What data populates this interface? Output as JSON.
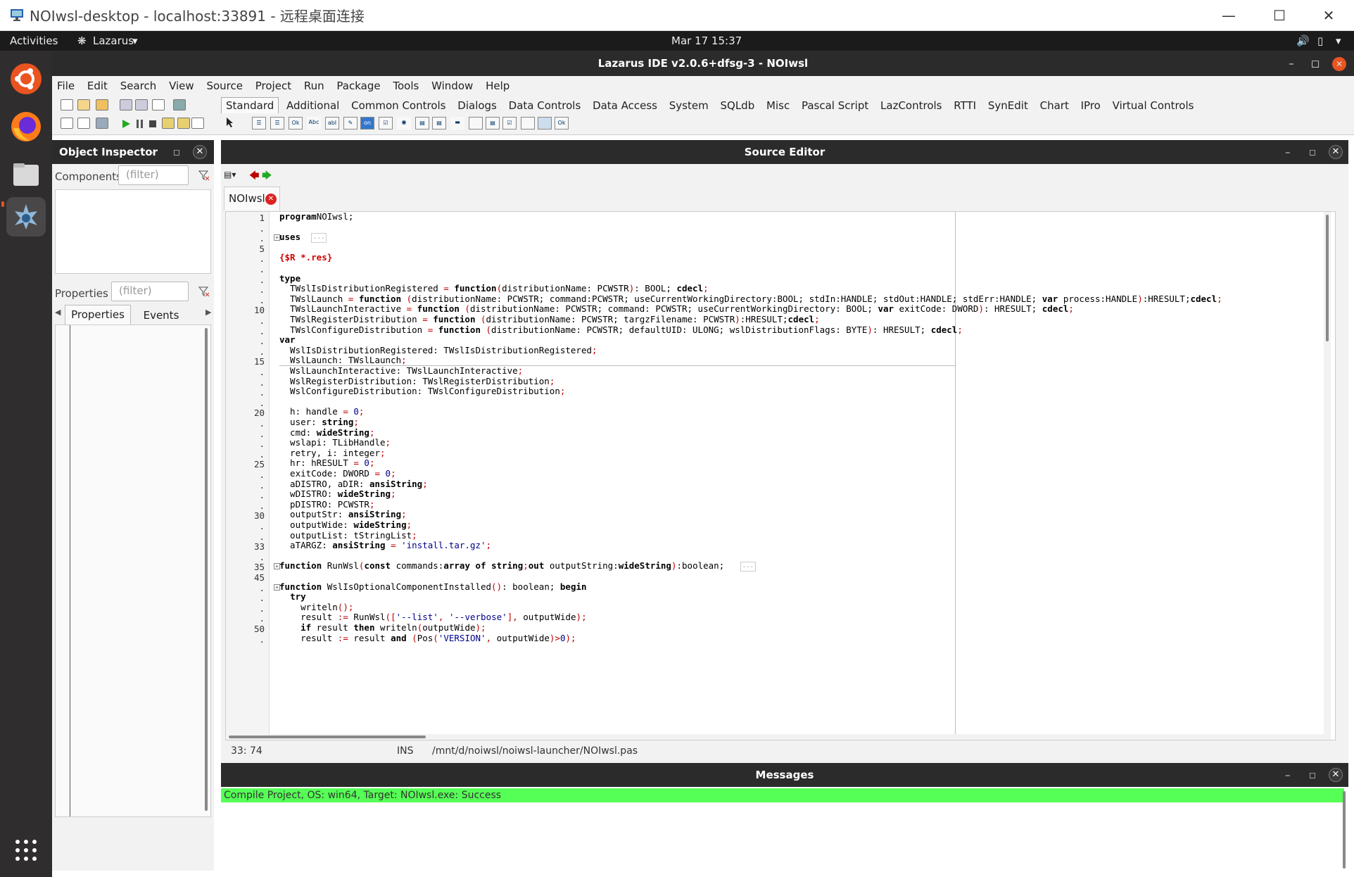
{
  "window": {
    "title": "NOIwsl-desktop - localhost:33891 - 远程桌面连接"
  },
  "gnome": {
    "activities": "Activities",
    "app": "Lazarus",
    "clock": "Mar 17  15:37"
  },
  "ide": {
    "title": "Lazarus IDE v2.0.6+dfsg-3 - NOIwsl"
  },
  "menu": [
    "File",
    "Edit",
    "Search",
    "View",
    "Source",
    "Project",
    "Run",
    "Package",
    "Tools",
    "Window",
    "Help"
  ],
  "component_tabs": [
    "Standard",
    "Additional",
    "Common Controls",
    "Dialogs",
    "Data Controls",
    "Data Access",
    "System",
    "SQLdb",
    "Misc",
    "Pascal Script",
    "LazControls",
    "RTTI",
    "SynEdit",
    "Chart",
    "IPro",
    "Virtual Controls"
  ],
  "palette_icons": [
    "Ok",
    "Abc",
    "abI",
    "on"
  ],
  "object_inspector": {
    "title": "Object Inspector",
    "components_label": "Components",
    "components_filter": "(filter)",
    "properties_label": "Properties",
    "properties_filter": "(filter)",
    "tabs": [
      "Properties",
      "Events"
    ]
  },
  "source_editor": {
    "title": "Source Editor",
    "file_tab": "NOIwsl",
    "gutter": [
      "1",
      ".",
      ".",
      "5",
      ".",
      ".",
      ".",
      ".",
      ".",
      "10",
      ".",
      ".",
      ".",
      ".",
      "15",
      ".",
      ".",
      ".",
      ".",
      "20",
      ".",
      ".",
      ".",
      ".",
      "25",
      ".",
      ".",
      ".",
      ".",
      "30",
      ".",
      ".",
      "33",
      ".",
      "35",
      "45",
      ".",
      ".",
      ".",
      ".",
      "50",
      "."
    ],
    "code": [
      [
        [
          "kw",
          "program"
        ],
        [
          "",
          "NOIwsl;"
        ]
      ],
      [],
      [
        [
          "kw",
          "uses"
        ],
        [
          "",
          "  "
        ],
        [
          "ellip",
          "..."
        ]
      ],
      [],
      [
        [
          "dir",
          "{$R *.res}"
        ]
      ],
      [],
      [
        [
          "kw",
          "type"
        ]
      ],
      [
        [
          "",
          "  TWslIsDistributionRegistered "
        ],
        [
          "sym",
          "="
        ],
        [
          "",
          ""
        ],
        [
          "kw",
          " function"
        ],
        [
          "sym",
          "("
        ],
        [
          "",
          "distributionName: PCWSTR"
        ],
        [
          "sym",
          ")"
        ],
        [
          "",
          ": BOOL; "
        ],
        [
          "kw",
          "cdecl"
        ],
        [
          "sym",
          ";"
        ]
      ],
      [
        [
          "",
          "  TWslLaunch "
        ],
        [
          "sym",
          "="
        ],
        [
          "kw",
          " function "
        ],
        [
          "sym",
          "("
        ],
        [
          "",
          "distributionName: PCWSTR; command:PCWSTR; useCurrentWorkingDirectory:BOOL; stdIn:HANDLE; stdOut:HANDLE; stdErr:HANDLE; "
        ],
        [
          "kw",
          "var"
        ],
        [
          "",
          " process:HANDLE"
        ],
        [
          "sym",
          ")"
        ],
        [
          "",
          ":HRESULT;"
        ],
        [
          "kw",
          "cdecl"
        ],
        [
          "sym",
          ";"
        ]
      ],
      [
        [
          "",
          "  TWslLaunchInteractive "
        ],
        [
          "sym",
          "="
        ],
        [
          "kw",
          " function "
        ],
        [
          "sym",
          "("
        ],
        [
          "",
          "distributionName: PCWSTR; command: PCWSTR; useCurrentWorkingDirectory: BOOL; "
        ],
        [
          "kw",
          "var"
        ],
        [
          "",
          " exitCode: DWORD"
        ],
        [
          "sym",
          ")"
        ],
        [
          "",
          ": HRESULT; "
        ],
        [
          "kw",
          "cdecl"
        ],
        [
          "sym",
          ";"
        ]
      ],
      [
        [
          "",
          "  TWslRegisterDistribution "
        ],
        [
          "sym",
          "="
        ],
        [
          "kw",
          " function "
        ],
        [
          "sym",
          "("
        ],
        [
          "",
          "distributionName: PCWSTR; targzFilename: PCWSTR"
        ],
        [
          "sym",
          ")"
        ],
        [
          "",
          ":HRESULT;"
        ],
        [
          "kw",
          "cdecl"
        ],
        [
          "sym",
          ";"
        ]
      ],
      [
        [
          "",
          "  TWslConfigureDistribution "
        ],
        [
          "sym",
          "="
        ],
        [
          "kw",
          " function "
        ],
        [
          "sym",
          "("
        ],
        [
          "",
          "distributionName: PCWSTR; defaultUID: ULONG; wslDistributionFlags: BYTE"
        ],
        [
          "sym",
          ")"
        ],
        [
          "",
          ": HRESULT; "
        ],
        [
          "kw",
          "cdecl"
        ],
        [
          "sym",
          ";"
        ]
      ],
      [
        [
          "kw",
          "var"
        ]
      ],
      [
        [
          "",
          "  WslIsDistributionRegistered: TWslIsDistributionRegistered"
        ],
        [
          "sym",
          ";"
        ]
      ],
      [
        [
          "",
          "  WslLaunch: TWslLaunch"
        ],
        [
          "sym",
          ";"
        ]
      ],
      [
        [
          "",
          "  WslLaunchInteractive: TWslLaunchInteractive"
        ],
        [
          "sym",
          ";"
        ]
      ],
      [
        [
          "",
          "  WslRegisterDistribution: TWslRegisterDistribution"
        ],
        [
          "sym",
          ";"
        ]
      ],
      [
        [
          "",
          "  WslConfigureDistribution: TWslConfigureDistribution"
        ],
        [
          "sym",
          ";"
        ]
      ],
      [],
      [
        [
          "",
          "  h: handle "
        ],
        [
          "sym",
          "="
        ],
        [
          "",
          " "
        ],
        [
          "str",
          "0"
        ],
        [
          "sym",
          ";"
        ]
      ],
      [
        [
          "",
          "  user: "
        ],
        [
          "kw",
          "string"
        ],
        [
          "sym",
          ";"
        ]
      ],
      [
        [
          "",
          "  cmd: "
        ],
        [
          "kw",
          "wideString"
        ],
        [
          "sym",
          ";"
        ]
      ],
      [
        [
          "",
          "  wslapi: TLibHandle"
        ],
        [
          "sym",
          ";"
        ]
      ],
      [
        [
          "",
          "  retry, i: integer"
        ],
        [
          "sym",
          ";"
        ]
      ],
      [
        [
          "",
          "  hr: hRESULT "
        ],
        [
          "sym",
          "="
        ],
        [
          "",
          " "
        ],
        [
          "str",
          "0"
        ],
        [
          "sym",
          ";"
        ]
      ],
      [
        [
          "",
          "  exitCode: DWORD "
        ],
        [
          "sym",
          "="
        ],
        [
          "",
          " "
        ],
        [
          "str",
          "0"
        ],
        [
          "sym",
          ";"
        ]
      ],
      [
        [
          "",
          "  aDISTRO, aDIR: "
        ],
        [
          "kw",
          "ansiString"
        ],
        [
          "sym",
          ";"
        ]
      ],
      [
        [
          "",
          "  wDISTRO: "
        ],
        [
          "kw",
          "wideString"
        ],
        [
          "sym",
          ";"
        ]
      ],
      [
        [
          "",
          "  pDISTRO: PCWSTR"
        ],
        [
          "sym",
          ";"
        ]
      ],
      [
        [
          "",
          "  outputStr: "
        ],
        [
          "kw",
          "ansiString"
        ],
        [
          "sym",
          ";"
        ]
      ],
      [
        [
          "",
          "  outputWide: "
        ],
        [
          "kw",
          "wideString"
        ],
        [
          "sym",
          ";"
        ]
      ],
      [
        [
          "",
          "  outputList: tStringList"
        ],
        [
          "sym",
          ";"
        ]
      ],
      [
        [
          "",
          "  aTARGZ: "
        ],
        [
          "kw",
          "ansiString"
        ],
        [
          "",
          " "
        ],
        [
          "sym",
          "="
        ],
        [
          "",
          " "
        ],
        [
          "str",
          "'install.tar.gz'"
        ],
        [
          "sym",
          ";"
        ]
      ],
      [],
      [
        [
          "kw",
          "function"
        ],
        [
          "",
          " RunWsl"
        ],
        [
          "sym",
          "("
        ],
        [
          "kw",
          "const"
        ],
        [
          "",
          " commands:"
        ],
        [
          "kw",
          "array of string"
        ],
        [
          "sym",
          ";"
        ],
        [
          "kw",
          "out"
        ],
        [
          "",
          " outputString:"
        ],
        [
          "kw",
          "wideString"
        ],
        [
          "sym",
          ")"
        ],
        [
          "",
          ":boolean;   "
        ],
        [
          "ellip",
          "..."
        ]
      ],
      [],
      [
        [
          "kw",
          "function"
        ],
        [
          "",
          " WslIsOptionalComponentInstalled"
        ],
        [
          "sym",
          "()"
        ],
        [
          "",
          ": boolean; "
        ],
        [
          "kw",
          "begin"
        ]
      ],
      [
        [
          "",
          "  "
        ],
        [
          "kw",
          "try"
        ]
      ],
      [
        [
          "",
          "    writeln"
        ],
        [
          "sym",
          "();"
        ]
      ],
      [
        [
          "",
          "    result "
        ],
        [
          "sym",
          ":="
        ],
        [
          "",
          " RunWsl"
        ],
        [
          "sym",
          "(["
        ],
        [
          "str",
          "'--list'"
        ],
        [
          "sym",
          ","
        ],
        [
          "",
          " "
        ],
        [
          "str",
          "'--verbose'"
        ],
        [
          "sym",
          "],"
        ],
        [
          "",
          " outputWide"
        ],
        [
          "sym",
          ");"
        ]
      ],
      [
        [
          "kw",
          "    if"
        ],
        [
          "",
          " result "
        ],
        [
          "kw",
          "then"
        ],
        [
          "",
          " writeln"
        ],
        [
          "sym",
          "("
        ],
        [
          "",
          "outputWide"
        ],
        [
          "sym",
          ");"
        ]
      ],
      [
        [
          "",
          "    result "
        ],
        [
          "sym",
          ":="
        ],
        [
          "",
          " result "
        ],
        [
          "kw",
          "and"
        ],
        [
          "",
          " "
        ],
        [
          "sym",
          "("
        ],
        [
          "",
          "Pos"
        ],
        [
          "sym",
          "("
        ],
        [
          "str",
          "'VERSION'"
        ],
        [
          "sym",
          ","
        ],
        [
          "",
          " outputWide"
        ],
        [
          "sym",
          ")>"
        ],
        [
          "str",
          "0"
        ],
        [
          "sym",
          ");"
        ]
      ]
    ]
  },
  "status_bar": {
    "pos": "33: 74",
    "mode": "INS",
    "path": "/mnt/d/noiwsl/noiwsl-launcher/NOIwsl.pas"
  },
  "messages": {
    "title": "Messages",
    "line": "Compile Project, OS: win64, Target: NOIwsl.exe: Success"
  },
  "colors": {
    "success": "#55ff55",
    "title_bar": "#2b2b2b",
    "dock": "#302d2e"
  }
}
